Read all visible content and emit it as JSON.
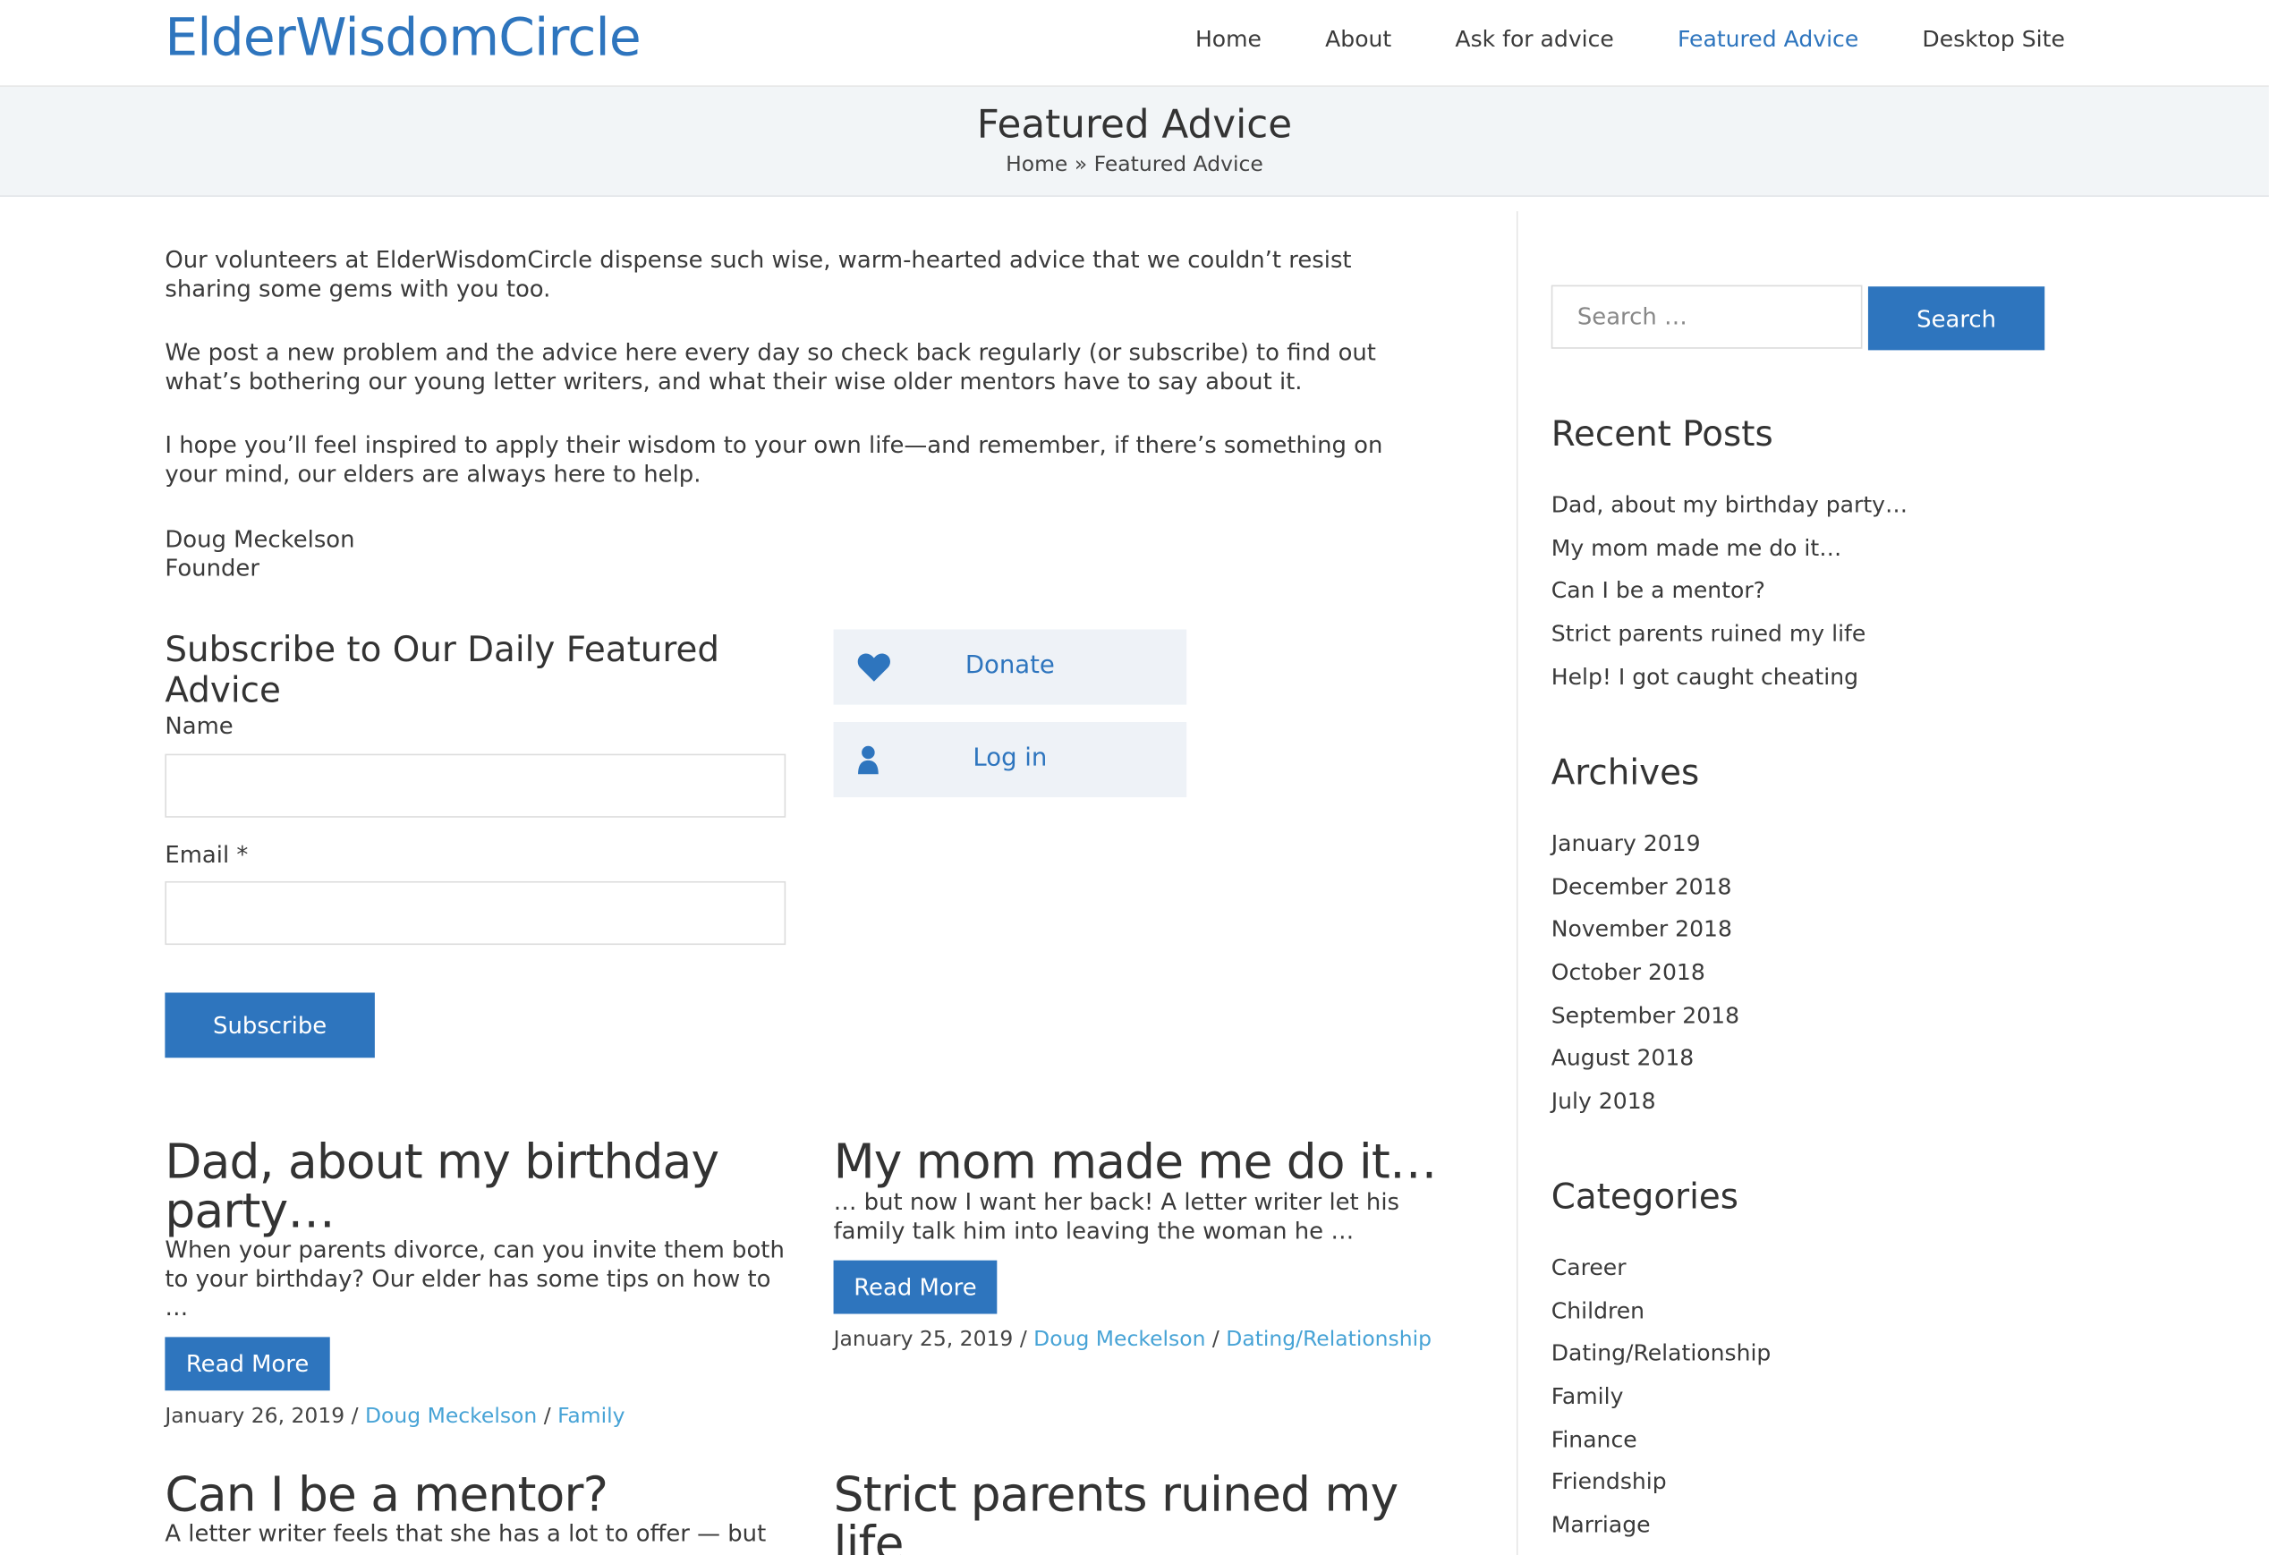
{
  "header": {
    "logo": "ElderWisdomCircle",
    "nav": [
      {
        "label": "Home",
        "active": false
      },
      {
        "label": "About",
        "active": false
      },
      {
        "label": "Ask for advice",
        "active": false
      },
      {
        "label": "Featured Advice",
        "active": true
      },
      {
        "label": "Desktop Site",
        "active": false
      }
    ]
  },
  "page": {
    "title": "Featured Advice",
    "breadcrumb": {
      "home": "Home",
      "separator": "»",
      "current": "Featured Advice"
    }
  },
  "intro": {
    "p1": "Our volunteers at ElderWisdomCircle dispense such wise, warm-hearted advice that we couldn’t resist sharing some gems with you too.",
    "p2": "We post a new problem and the advice here every day so check back regularly (or subscribe)  to find out what’s bothering our young letter writers, and what their wise older mentors have to say about it.",
    "p3": "I hope you’ll feel inspired to apply their wisdom to your own life—and remember, if there’s something on your mind, our elders are always here to help.",
    "signature_name": "Doug Meckelson",
    "signature_role": "Founder"
  },
  "subscribe": {
    "title": "Subscribe to Our Daily Featured Advice",
    "name_label": "Name",
    "name_value": "",
    "email_label": "Email *",
    "email_value": "",
    "button": "Subscribe"
  },
  "actions": {
    "donate": "Donate",
    "login": "Log in"
  },
  "posts": [
    {
      "title": "Dad, about my birthday party…",
      "excerpt": "When your parents divorce, can you invite them both to your birthday? Our elder has some tips on how to …",
      "read_more": "Read More",
      "date": "January 26, 2019",
      "author": "Doug Meckelson",
      "category": "Family"
    },
    {
      "title": "My mom made me do it…",
      "excerpt": "… but now I want her back! A letter writer let his family talk him into leaving the woman he …",
      "read_more": "Read More",
      "date": "January 25, 2019",
      "author": "Doug Meckelson",
      "category": "Dating/Relationship"
    },
    {
      "title": "Can I be a mentor?",
      "excerpt": "A letter writer feels that she has a lot to offer — but"
    },
    {
      "title": "Strict parents ruined my life"
    }
  ],
  "meta_separator": "/",
  "sidebar": {
    "search_placeholder": "Search …",
    "search_button": "Search",
    "recent_title": "Recent Posts",
    "recent": [
      "Dad, about my birthday party…",
      "My mom made me do it…",
      "Can I be a mentor?",
      "Strict parents ruined my life",
      "Help! I got caught cheating"
    ],
    "archives_title": "Archives",
    "archives": [
      "January 2019",
      "December 2018",
      "November 2018",
      "October 2018",
      "September 2018",
      "August 2018",
      "July 2018"
    ],
    "categories_title": "Categories",
    "categories": [
      "Career",
      "Children",
      "Dating/Relationship",
      "Family",
      "Finance",
      "Friendship",
      "Marriage"
    ]
  },
  "colors": {
    "brand_blue": "#2e75be",
    "link_blue": "#47a3d6",
    "banner_bg": "#f2f5f7",
    "card_bg": "#eef2f7"
  },
  "icons": {
    "donate": "heart-icon",
    "login": "user-icon"
  }
}
